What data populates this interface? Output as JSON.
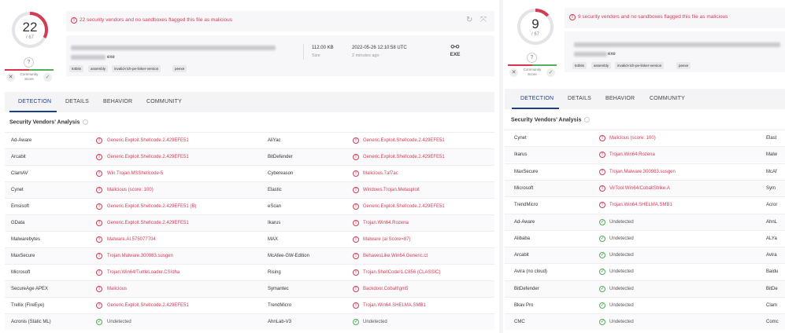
{
  "colors": {
    "malicious": "#d23c55",
    "undetected": "#52b05a",
    "accent": "#1a3f8c"
  },
  "left": {
    "score": {
      "detections": "22",
      "total": "/ 67",
      "fraction": 0.328
    },
    "community": {
      "question_icon": "?",
      "label": "Community Score"
    },
    "alert": "22 security vendors and no sandboxes flagged this file as malicious",
    "file": {
      "name_suffix": "exe",
      "tags": [
        "64bits",
        "assembly",
        "invalid-rich-pe-linker-version",
        "peexe"
      ],
      "size_value": "112.00 KB",
      "size_label": "Size",
      "date_value": "2022-05-26 12:10:58 UTC",
      "date_label": "2 minutes ago",
      "type_label": "EXE",
      "type_icon": "exe-file-icon"
    },
    "tabs": [
      "DETECTION",
      "DETAILS",
      "BEHAVIOR",
      "COMMUNITY"
    ],
    "section_title": "Security Vendors' Analysis",
    "rows": [
      {
        "v1": "Ad-Aware",
        "r1": "Generic.Exploit.Shellcode.2.429EFE51",
        "s1": "mal",
        "v2": "AliYac",
        "r2": "Generic.Exploit.Shellcode.2.429EFE51",
        "s2": "mal"
      },
      {
        "v1": "Arcabit",
        "r1": "Generic.Exploit.Shellcode.2.429EFE51",
        "s1": "mal",
        "v2": "BitDefender",
        "r2": "Generic.Exploit.Shellcode.2.429EFE51",
        "s2": "mal"
      },
      {
        "v1": "ClamAV",
        "r1": "Win.Trojan.MSShellcode-5",
        "s1": "mal",
        "v2": "Cybereason",
        "r2": "Malicious.7af7ac",
        "s2": "mal"
      },
      {
        "v1": "Cynet",
        "r1": "Malicious (score: 100)",
        "s1": "mal",
        "v2": "Elastic",
        "r2": "Windows.Trojan.Metasploit",
        "s2": "mal"
      },
      {
        "v1": "Emsisoft",
        "r1": "Generic.Exploit.Shellcode.2.429EFE51 (B)",
        "s1": "mal",
        "v2": "eScan",
        "r2": "Generic.Exploit.Shellcode.2.429EFE51",
        "s2": "mal"
      },
      {
        "v1": "GData",
        "r1": "Generic.Exploit.Shellcode.2.429EFE51",
        "s1": "mal",
        "v2": "Ikarus",
        "r2": "Trojan.Win64.Rozena",
        "s2": "mal"
      },
      {
        "v1": "Malwarebytes",
        "r1": "Malware.AI.575077704",
        "s1": "mal",
        "v2": "MAX",
        "r2": "Malware (ai Score=87)",
        "s2": "mal"
      },
      {
        "v1": "MaxSecure",
        "r1": "Trojan.Malware.300983.susgen",
        "s1": "mal",
        "v2": "McAfee-GW-Edition",
        "r2": "BehavesLike.Win64.Generic.ct",
        "s2": "mal"
      },
      {
        "v1": "Microsoft",
        "r1": "Trojan:Win64/TurtleLoader.CS!dha",
        "s1": "mal",
        "v2": "Rising",
        "r2": "Trojan.ShellCode!1.C856 (CLASSIC)",
        "s2": "mal"
      },
      {
        "v1": "SecureAge APEX",
        "r1": "Malicious",
        "s1": "mal",
        "v2": "Symantec",
        "r2": "Backdoor.Cobalt!gm5",
        "s2": "mal"
      },
      {
        "v1": "Trellix (FireEye)",
        "r1": "Generic.Exploit.Shellcode.2.429EFE51",
        "s1": "mal",
        "v2": "TrendMicro",
        "r2": "Trojan.Win64.SHELMA.SMB1",
        "s2": "mal"
      },
      {
        "v1": "Acronis (Static ML)",
        "r1": "Undetected",
        "s1": "und",
        "v2": "AhnLab-V3",
        "r2": "Undetected",
        "s2": "und"
      }
    ]
  },
  "right": {
    "score": {
      "detections": "9",
      "total": "/ 67",
      "fraction": 0.134
    },
    "community": {
      "question_icon": "?",
      "label": "Community Score"
    },
    "alert": "9 security vendors and no sandboxes flagged this file as malicious",
    "file": {
      "name_suffix": "exe",
      "tags": [
        "64bits",
        "assembly",
        "invalid-rich-pe-linker-version",
        "peexe"
      ]
    },
    "tabs": [
      "DETECTION",
      "DETAILS",
      "BEHAVIOR",
      "COMMUNITY"
    ],
    "section_title": "Security Vendors' Analysis",
    "rows": [
      {
        "v1": "Cynet",
        "r1": "Malicious (score: 100)",
        "s1": "mal",
        "v2": "Elast"
      },
      {
        "v1": "Ikarus",
        "r1": "Trojan.Win64.Rozena",
        "s1": "mal",
        "v2": "Malw"
      },
      {
        "v1": "MaxSecure",
        "r1": "Trojan.Malware.300983.susgen",
        "s1": "mal",
        "v2": "McAf"
      },
      {
        "v1": "Microsoft",
        "r1": "VirTool:Win64/CobaltStrike.A",
        "s1": "mal",
        "v2": "Sym"
      },
      {
        "v1": "TrendMicro",
        "r1": "Trojan.Win64.SHELMA.SMB1",
        "s1": "mal",
        "v2": "Acror"
      },
      {
        "v1": "Ad-Aware",
        "r1": "Undetected",
        "s1": "und",
        "v2": "AhnL"
      },
      {
        "v1": "Alibaba",
        "r1": "Undetected",
        "s1": "und",
        "v2": "ALYa"
      },
      {
        "v1": "Arcabit",
        "r1": "Undetected",
        "s1": "und",
        "v2": "Avira"
      },
      {
        "v1": "Avira (no cloud)",
        "r1": "Undetected",
        "s1": "und",
        "v2": "Baidu"
      },
      {
        "v1": "BitDefender",
        "r1": "Undetected",
        "s1": "und",
        "v2": "BitDe"
      },
      {
        "v1": "Bkav Pro",
        "r1": "Undetected",
        "s1": "und",
        "v2": "Clam"
      },
      {
        "v1": "CMC",
        "r1": "Undetected",
        "s1": "und",
        "v2": "Comc"
      }
    ]
  }
}
